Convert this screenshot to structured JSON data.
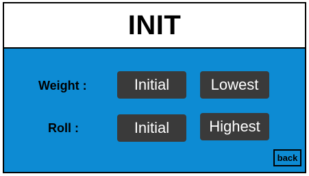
{
  "header": {
    "title": "INIT"
  },
  "rows": [
    {
      "label": "Weight :",
      "buttons": [
        "Initial",
        "Lowest"
      ]
    },
    {
      "label": "Roll :",
      "buttons": [
        "Initial",
        "Highest"
      ]
    }
  ],
  "footer": {
    "back_label": "back"
  },
  "colors": {
    "panel_background": "#0d8bd3",
    "button_background": "#3a3a3a",
    "button_text": "#ffffff",
    "label_text": "#000000"
  }
}
